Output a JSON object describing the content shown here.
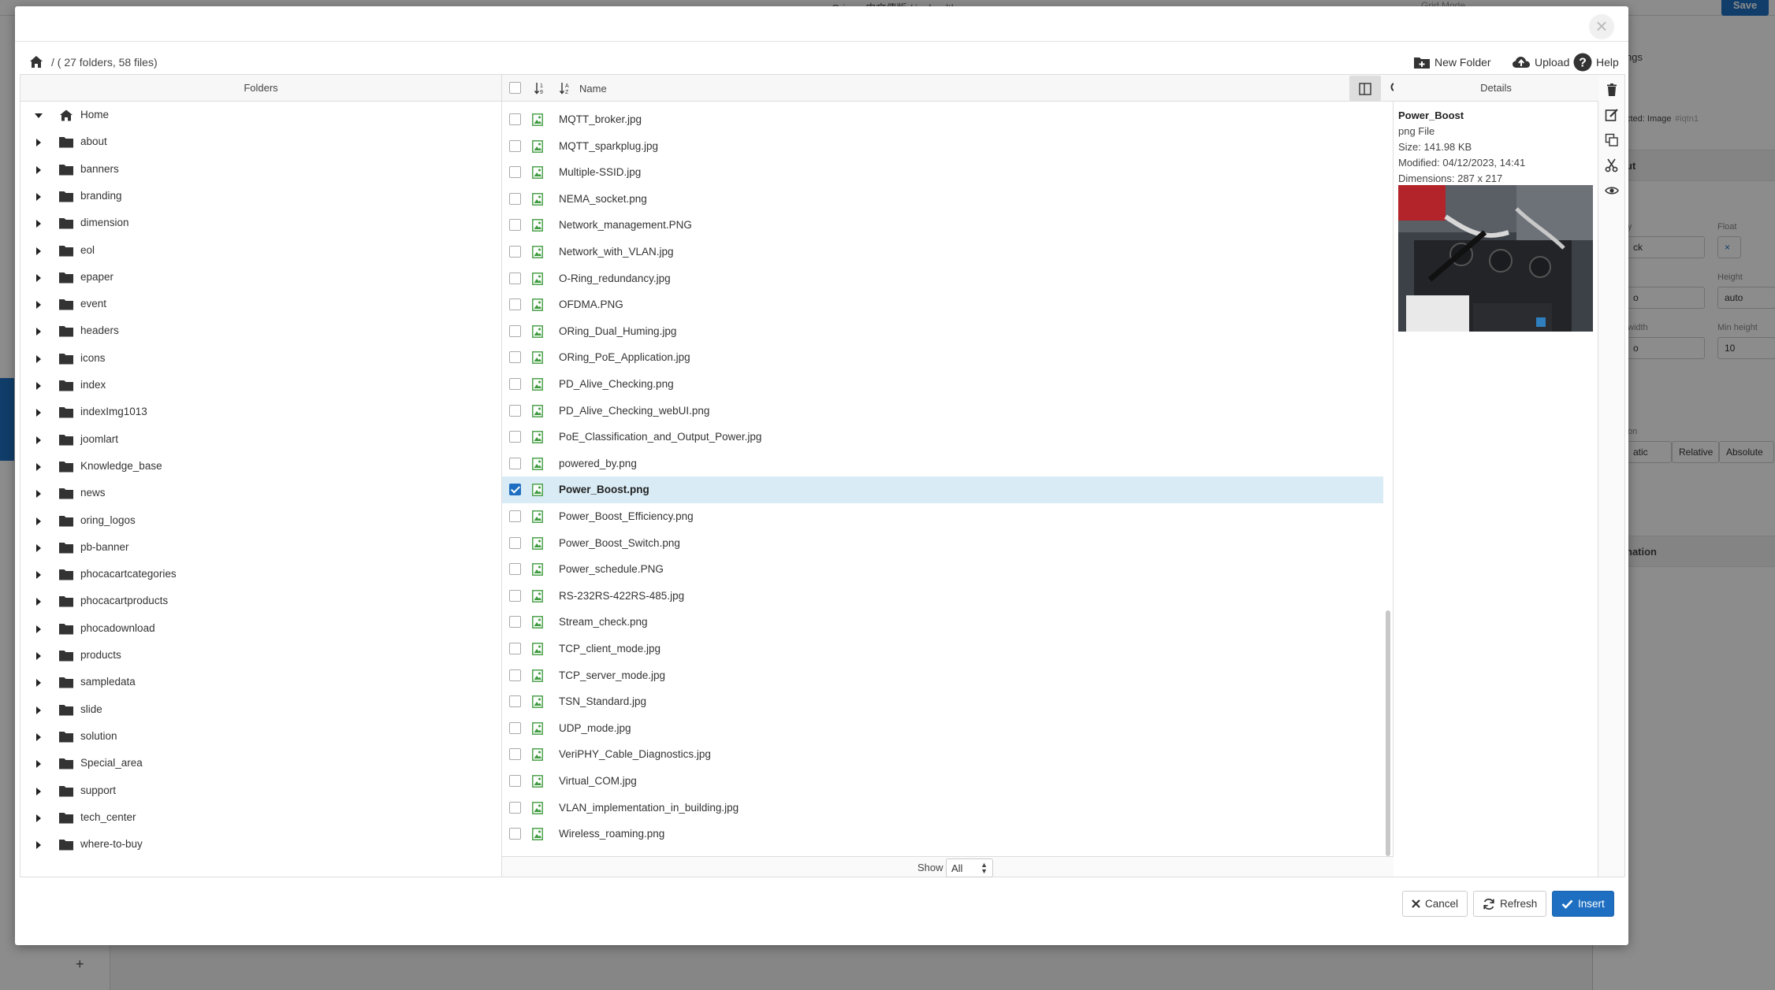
{
  "background_app": {
    "topbar": {
      "tab_title": "Oring - 中文傳版 / ia_healthcare",
      "grid_mode": "Grid Mode",
      "save_label": "Save"
    },
    "right_panel": {
      "section_settings": "ngs",
      "selected_text": "cted: Image",
      "selected_id": "#iqtn1",
      "layout_section": "ut",
      "display_label": "y",
      "display_value": "ck",
      "float_label": "Float",
      "float_value": "×",
      "height_label": "Height",
      "height_value": "auto",
      "width_label": "width",
      "min_height_label": "Min height",
      "min_height_value": "10",
      "position_label": "on",
      "pos_static": "atic",
      "pos_relative": "Relative",
      "pos_absolute": "Absolute",
      "animation_section": "nation",
      "auto_short": "o"
    },
    "add_button": "+"
  },
  "modal": {
    "close_label": "×",
    "breadcrumb": {
      "separator": "/",
      "summary": "( 27 folders, 58 files)"
    },
    "toolbar": {
      "new_folder": "New Folder",
      "upload": "Upload",
      "help": "Help"
    },
    "folders_header": "Folders",
    "files_header": {
      "name": "Name",
      "sort_a": "↓",
      "sort_b": "↓"
    },
    "details_header": "Details",
    "folders": [
      {
        "label": "Home",
        "open": true,
        "home": true
      },
      {
        "label": "about"
      },
      {
        "label": "banners"
      },
      {
        "label": "branding"
      },
      {
        "label": "dimension"
      },
      {
        "label": "eol"
      },
      {
        "label": "epaper"
      },
      {
        "label": "event"
      },
      {
        "label": "headers"
      },
      {
        "label": "icons"
      },
      {
        "label": "index"
      },
      {
        "label": "indexImg1013"
      },
      {
        "label": "joomlart"
      },
      {
        "label": "Knowledge_base"
      },
      {
        "label": "news"
      },
      {
        "label": "oring_logos"
      },
      {
        "label": "pb-banner"
      },
      {
        "label": "phocacartcategories"
      },
      {
        "label": "phocacartproducts"
      },
      {
        "label": "phocadownload"
      },
      {
        "label": "products"
      },
      {
        "label": "sampledata"
      },
      {
        "label": "slide"
      },
      {
        "label": "solution"
      },
      {
        "label": "Special_area"
      },
      {
        "label": "support"
      },
      {
        "label": "tech_center"
      },
      {
        "label": "where-to-buy"
      }
    ],
    "files": [
      {
        "name": "MQTT_broker.jpg"
      },
      {
        "name": "MQTT_sparkplug.jpg"
      },
      {
        "name": "Multiple-SSID.jpg"
      },
      {
        "name": "NEMA_socket.png"
      },
      {
        "name": "Network_management.PNG"
      },
      {
        "name": "Network_with_VLAN.jpg"
      },
      {
        "name": "O-Ring_redundancy.jpg"
      },
      {
        "name": "OFDMA.PNG"
      },
      {
        "name": "ORing_Dual_Huming.jpg"
      },
      {
        "name": "ORing_PoE_Application.jpg"
      },
      {
        "name": "PD_Alive_Checking.png"
      },
      {
        "name": "PD_Alive_Checking_webUI.png"
      },
      {
        "name": "PoE_Classification_and_Output_Power.jpg"
      },
      {
        "name": "powered_by.png"
      },
      {
        "name": "Power_Boost.png",
        "selected": true
      },
      {
        "name": "Power_Boost_Efficiency.png"
      },
      {
        "name": "Power_Boost_Switch.png"
      },
      {
        "name": "Power_schedule.PNG"
      },
      {
        "name": "RS-232RS-422RS-485.jpg"
      },
      {
        "name": "Stream_check.png"
      },
      {
        "name": "TCP_client_mode.jpg"
      },
      {
        "name": "TCP_server_mode.jpg"
      },
      {
        "name": "TSN_Standard.jpg"
      },
      {
        "name": "UDP_mode.jpg"
      },
      {
        "name": "VeriPHY_Cable_Diagnostics.jpg"
      },
      {
        "name": "Virtual_COM.jpg"
      },
      {
        "name": "VLAN_implementation_in_building.jpg"
      },
      {
        "name": "Wireless_roaming.png"
      }
    ],
    "footer_show": {
      "label": "Show",
      "value": "All"
    },
    "details": {
      "title": "Power_Boost",
      "type": "png File",
      "size": "Size: 141.98 KB",
      "modified": "Modified: 04/12/2023, 14:41",
      "dimensions": "Dimensions: 287 x 217"
    },
    "buttons": {
      "cancel": "Cancel",
      "refresh": "Refresh",
      "insert": "Insert"
    }
  },
  "colors": {
    "accent": "#1e6fc1",
    "selected_row": "#d9ebf5",
    "image_icon": "#3f9b3f"
  }
}
